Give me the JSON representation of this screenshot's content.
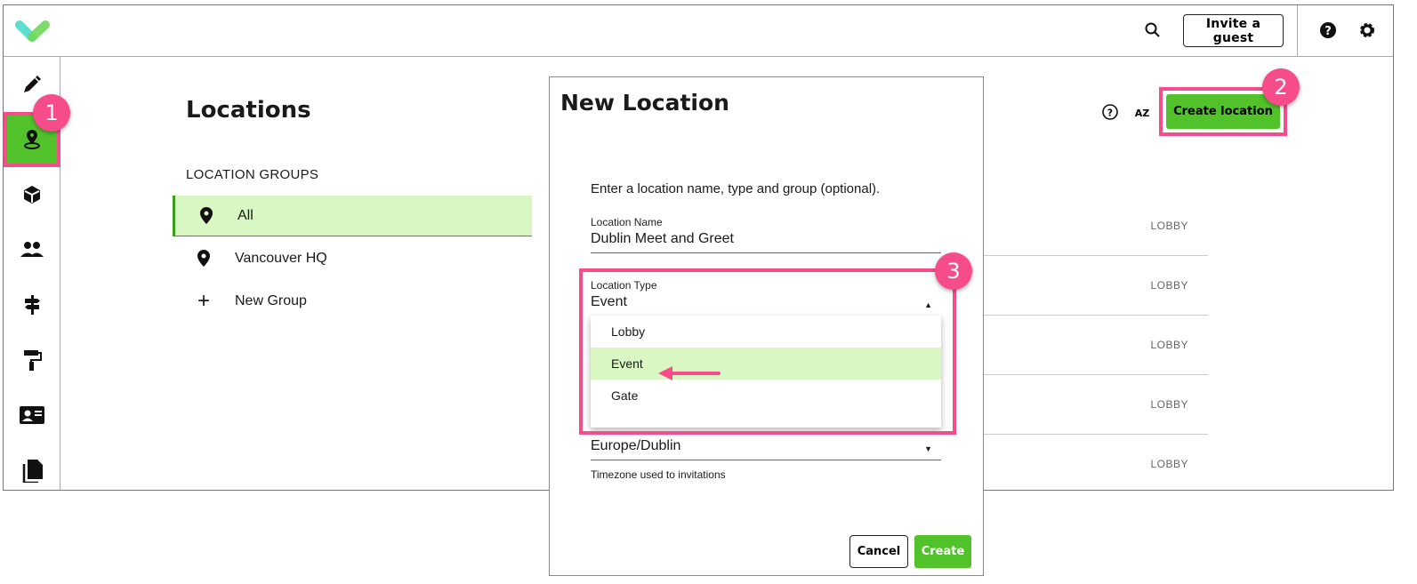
{
  "header": {
    "invite_label": "Invite a guest",
    "icons": [
      "search-icon",
      "help-icon",
      "gear-icon"
    ]
  },
  "sidebar": {
    "items": [
      "pen-icon",
      "location-icon",
      "package-icon",
      "people-icon",
      "signpost-icon",
      "paint-roller-icon",
      "id-card-icon",
      "documents-icon"
    ],
    "active": "location-icon"
  },
  "page": {
    "title": "Locations",
    "groups_heading": "LOCATION GROUPS",
    "groups": [
      {
        "label": "All",
        "icon": "location-icon"
      },
      {
        "label": "Vancouver HQ",
        "icon": "location-icon"
      },
      {
        "label": "New Group",
        "icon": "plus-icon"
      }
    ],
    "create_label": "Create location",
    "rows": [
      "LOBBY",
      "LOBBY",
      "LOBBY",
      "LOBBY",
      "LOBBY"
    ]
  },
  "dialog": {
    "title": "New Location",
    "intro": "Enter a location name, type and group (optional).",
    "name_label": "Location Name",
    "name_value": "Dublin Meet and Greet",
    "type_label": "Location Type",
    "type_value": "Event",
    "type_options": [
      "Lobby",
      "Event",
      "Gate"
    ],
    "timezone_value": "Europe/Dublin",
    "timezone_hint": "Timezone used to invitations",
    "cancel_label": "Cancel",
    "create_label": "Create"
  },
  "annotations": {
    "badges": [
      "1",
      "2",
      "3"
    ],
    "color": "#f64c8a"
  },
  "colors": {
    "accent": "#52c22b",
    "selected_bg": "#d8f7c2"
  }
}
